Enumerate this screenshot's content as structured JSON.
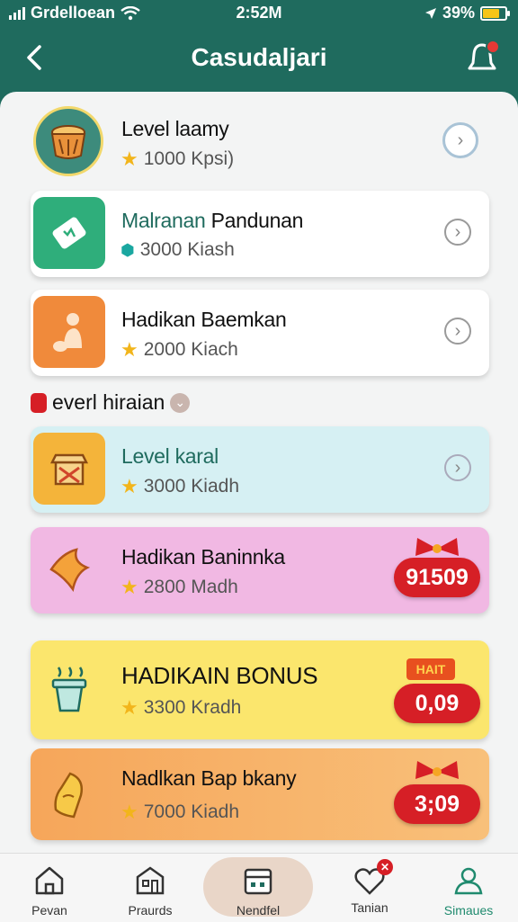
{
  "status": {
    "carrier": "Grdelloean",
    "time": "2:52M",
    "battery": "39%"
  },
  "header": {
    "title": "Casudaljari"
  },
  "cards": [
    {
      "title": "Level laamy",
      "points": "1000 Kpsi)",
      "action": "chevron"
    },
    {
      "title_a": "Malranan",
      "title_b": "Pandunan",
      "points": "3000 Kiash",
      "action": "chevron"
    },
    {
      "title": "Hadikan Baemkan",
      "points": "2000 Kiach",
      "action": "chevron"
    }
  ],
  "section": {
    "label": "everl hiraian"
  },
  "bonus_cards": [
    {
      "title": "Level karal",
      "points": "3000 Kiadh",
      "action": "chevron"
    },
    {
      "title": "Hadikan Baninnka",
      "points": "2800 Madh",
      "badge": "91509"
    },
    {
      "title": "HADIKAIN BONUS",
      "points": "3300 Kradh",
      "badge": "0,09",
      "badge_top": "HAIT"
    },
    {
      "title": "Nadlkan Bap bkany",
      "points": "7000 Kiadh",
      "badge": "3;09"
    }
  ],
  "tabs": [
    {
      "label": "Pevan"
    },
    {
      "label": "Praurds"
    },
    {
      "label": "Nendfel"
    },
    {
      "label": "Tanian"
    },
    {
      "label": "Simaues"
    }
  ],
  "colors": {
    "header": "#1f6b5e",
    "card2_icon": "#2fae7b",
    "card3_icon": "#f08a3b",
    "bonus1_bg": "#d6f0f3",
    "bonus2_bg": "#f1b8e3",
    "bonus3_bg": "#fbe66d",
    "bonus4_bg": "#f6b062",
    "badge": "#d61f26"
  }
}
